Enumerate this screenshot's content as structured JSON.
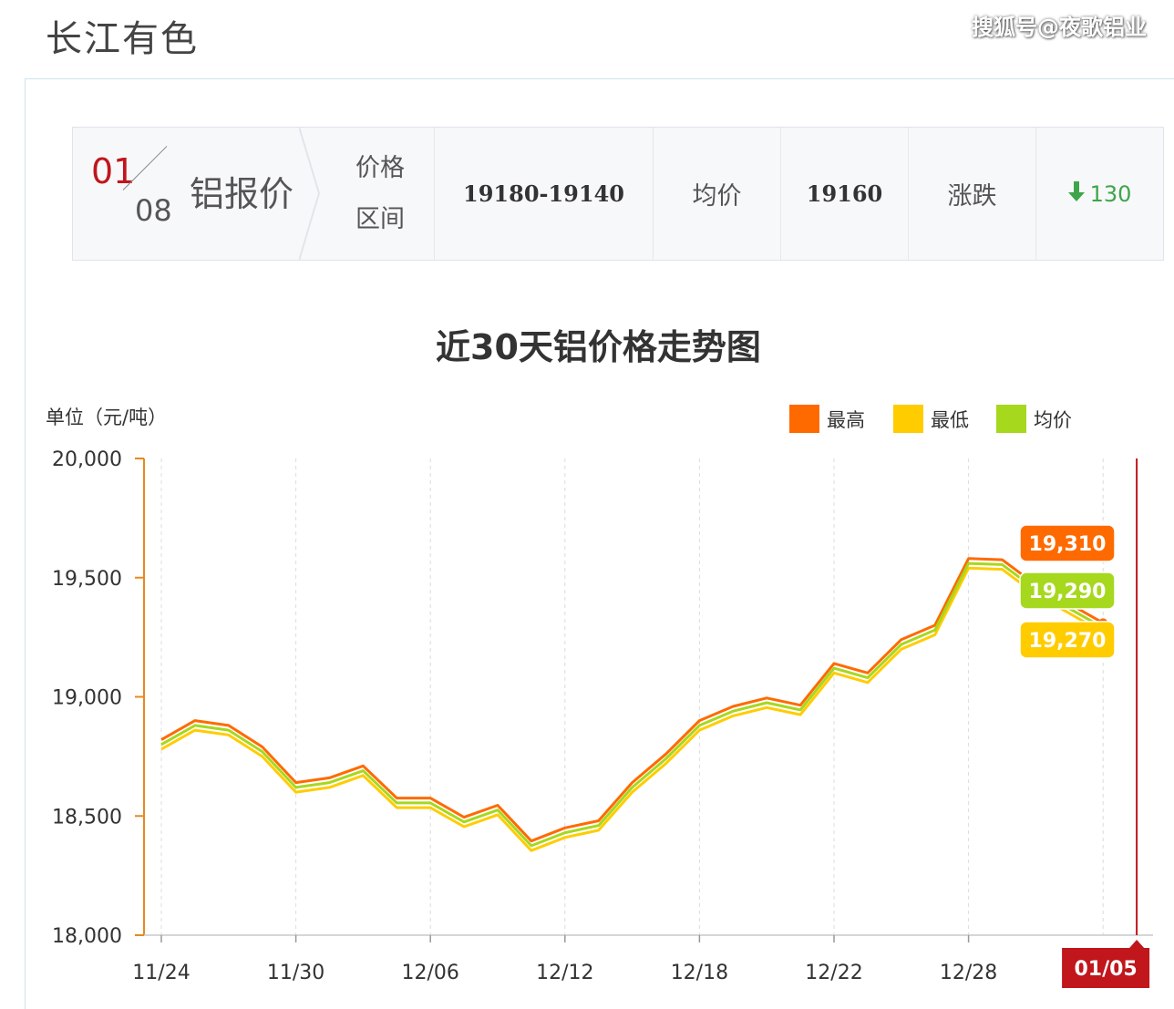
{
  "site": {
    "title": "长江有色",
    "watermark": "搜狐号@夜歌铝业"
  },
  "quote": {
    "month": "01",
    "day": "08",
    "label": "铝报价",
    "range_label_1": "价格",
    "range_label_2": "区间",
    "range_value": "19180-19140",
    "avg_label": "均价",
    "avg_value": "19160",
    "change_label": "涨跌",
    "change_value": "130",
    "change_icon": "arrow-down-icon",
    "change_color": "#3ea54a"
  },
  "chart_data": {
    "type": "line",
    "title": "近30天铝价格走势图",
    "ylabel": "单位（元/吨）",
    "ylim": [
      18000,
      20000
    ],
    "yticks": [
      "18,000",
      "18,500",
      "19,000",
      "19,500",
      "20,000"
    ],
    "ytick_values": [
      18000,
      18500,
      19000,
      19500,
      20000
    ],
    "xtick_labels": [
      "11/24",
      "11/30",
      "12/06",
      "12/12",
      "12/18",
      "12/22",
      "12/28"
    ],
    "x_index_range": [
      0,
      29
    ],
    "xtick_index": [
      0,
      4,
      8,
      12,
      16,
      20,
      24
    ],
    "highlight": {
      "label": "01/05",
      "index": 29
    },
    "legend_position": "top-right",
    "series": [
      {
        "name": "最高",
        "color": "#ff6a00",
        "values": [
          18820,
          18900,
          18880,
          18790,
          18640,
          18660,
          18710,
          18575,
          18575,
          18495,
          18545,
          18395,
          18450,
          18480,
          18640,
          18760,
          18900,
          18960,
          18995,
          18965,
          19140,
          19100,
          19240,
          19300,
          19580,
          19575,
          19470,
          19390,
          19310
        ]
      },
      {
        "name": "最低",
        "color": "#ffcc00",
        "values": [
          18780,
          18860,
          18840,
          18750,
          18600,
          18620,
          18670,
          18535,
          18535,
          18455,
          18505,
          18355,
          18410,
          18440,
          18600,
          18720,
          18860,
          18920,
          18955,
          18925,
          19100,
          19060,
          19200,
          19260,
          19540,
          19535,
          19430,
          19350,
          19270
        ]
      },
      {
        "name": "均价",
        "color": "#a6d81e",
        "values": [
          18800,
          18880,
          18860,
          18770,
          18620,
          18640,
          18690,
          18555,
          18555,
          18475,
          18525,
          18375,
          18430,
          18460,
          18620,
          18740,
          18880,
          18940,
          18975,
          18945,
          19120,
          19080,
          19220,
          19280,
          19560,
          19555,
          19450,
          19370,
          19290
        ]
      }
    ],
    "tooltip": [
      {
        "label": "19,310",
        "color": "#ff6a00",
        "value": 19310
      },
      {
        "label": "19,290",
        "color": "#a6d81e",
        "value": 19290
      },
      {
        "label": "19,270",
        "color": "#ffcc00",
        "value": 19270
      }
    ],
    "axis_color": "#e58a1f",
    "grid": true
  }
}
